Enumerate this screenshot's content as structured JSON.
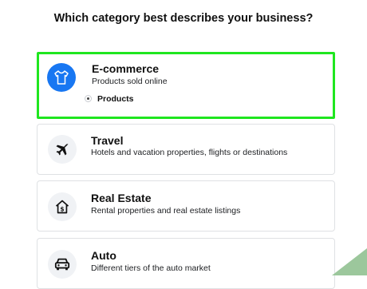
{
  "question": "Which category best describes your business?",
  "categories": [
    {
      "title": "E-commerce",
      "description": "Products sold online",
      "icon": "tshirt-icon",
      "selected": true,
      "sub_option": "Products"
    },
    {
      "title": "Travel",
      "description": "Hotels and vacation properties, flights or destinations",
      "icon": "airplane-icon",
      "selected": false
    },
    {
      "title": "Real Estate",
      "description": "Rental properties and real estate listings",
      "icon": "house-dollar-icon",
      "selected": false
    },
    {
      "title": "Auto",
      "description": "Different tiers of the auto market",
      "icon": "car-icon",
      "selected": false
    }
  ],
  "colors": {
    "selected_border": "#1fe61f",
    "icon_accent": "#1877f2",
    "icon_bg": "#f0f2f5"
  }
}
